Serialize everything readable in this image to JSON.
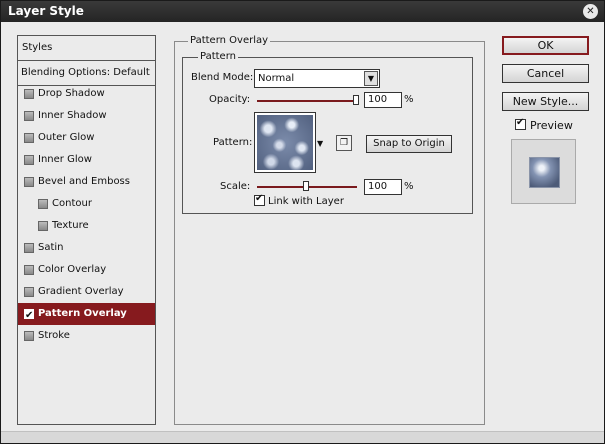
{
  "window": {
    "title": "Layer Style",
    "close_glyph": "✕"
  },
  "styles_panel": {
    "header": "Styles",
    "blending_options": "Blending Options: Default",
    "items": [
      {
        "label": "Drop Shadow",
        "checked": false,
        "indent": false
      },
      {
        "label": "Inner Shadow",
        "checked": false,
        "indent": false
      },
      {
        "label": "Outer Glow",
        "checked": false,
        "indent": false
      },
      {
        "label": "Inner Glow",
        "checked": false,
        "indent": false
      },
      {
        "label": "Bevel and Emboss",
        "checked": false,
        "indent": false
      },
      {
        "label": "Contour",
        "checked": false,
        "indent": true
      },
      {
        "label": "Texture",
        "checked": false,
        "indent": true
      },
      {
        "label": "Satin",
        "checked": false,
        "indent": false
      },
      {
        "label": "Color Overlay",
        "checked": false,
        "indent": false
      },
      {
        "label": "Gradient Overlay",
        "checked": false,
        "indent": false
      },
      {
        "label": "Pattern Overlay",
        "checked": true,
        "indent": false,
        "selected": true
      },
      {
        "label": "Stroke",
        "checked": false,
        "indent": false
      }
    ]
  },
  "pattern_overlay": {
    "section_title": "Pattern Overlay",
    "group_title": "Pattern",
    "blend_mode_label": "Blend Mode:",
    "blend_mode_value": "Normal",
    "opacity_label": "Opacity:",
    "opacity_value": "100",
    "opacity_level": 1.0,
    "percent": "%",
    "pattern_label": "Pattern:",
    "snap_button": "Snap to Origin",
    "scale_label": "Scale:",
    "scale_value": "100",
    "scale_level": 0.5,
    "link_label": "Link with Layer",
    "link_checked": true
  },
  "buttons": {
    "ok": "OK",
    "cancel": "Cancel",
    "new_style": "New Style..."
  },
  "preview": {
    "label": "Preview",
    "checked": true
  },
  "colors": {
    "selection": "#861a1e",
    "title_bar": "#2e2e2e",
    "background": "#ebebeb"
  }
}
